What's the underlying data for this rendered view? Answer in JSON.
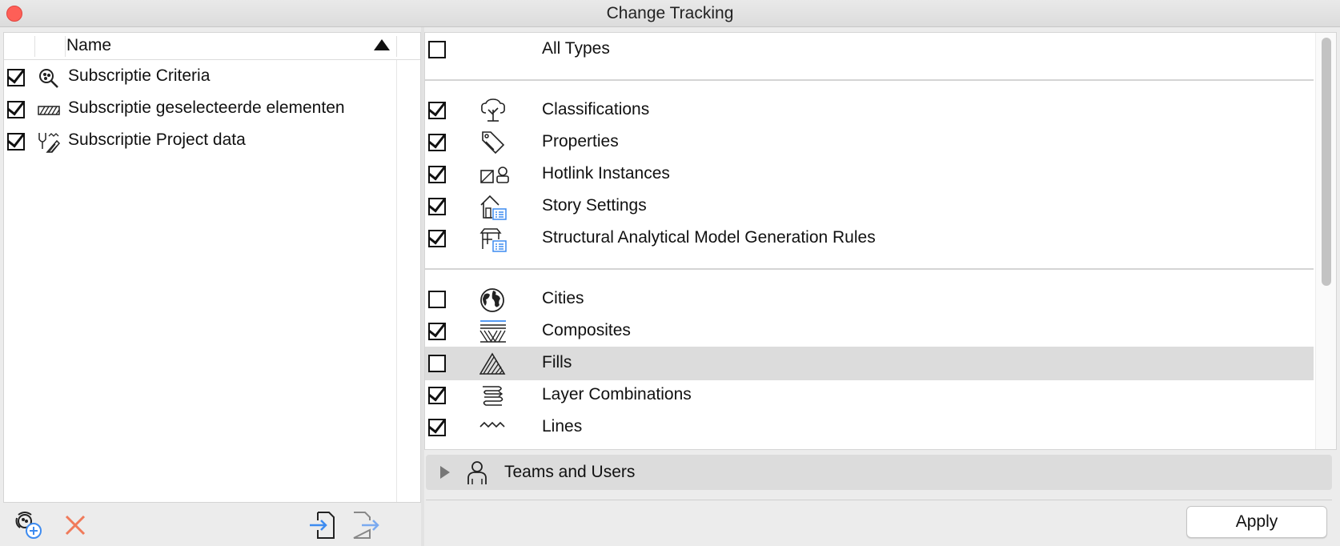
{
  "window": {
    "title": "Change Tracking"
  },
  "left": {
    "column_name": "Name",
    "rows": [
      {
        "label": "Subscriptie Criteria",
        "checked": true,
        "icon": "criteria-search-icon"
      },
      {
        "label": "Subscriptie geselecteerde elementen",
        "checked": true,
        "icon": "hatched-element-icon"
      },
      {
        "label": "Subscriptie Project data",
        "checked": true,
        "icon": "project-data-icon"
      }
    ],
    "toolbar": [
      "add-subscription-icon",
      "delete-icon",
      "import-icon",
      "export-icon"
    ]
  },
  "right": {
    "groups": [
      [
        {
          "label": "All Types",
          "checked": false,
          "icon": ""
        }
      ],
      [
        {
          "label": "Classifications",
          "checked": true,
          "icon": "tree-icon"
        },
        {
          "label": "Properties",
          "checked": true,
          "icon": "tag-icon"
        },
        {
          "label": "Hotlink Instances",
          "checked": true,
          "icon": "hotlink-icon"
        },
        {
          "label": "Story Settings",
          "checked": true,
          "icon": "story-settings-icon"
        },
        {
          "label": "Structural Analytical Model Generation Rules",
          "checked": true,
          "icon": "structural-model-icon"
        }
      ],
      [
        {
          "label": "Cities",
          "checked": false,
          "icon": "globe-icon"
        },
        {
          "label": "Composites",
          "checked": true,
          "icon": "composite-icon"
        },
        {
          "label": "Fills",
          "checked": false,
          "icon": "fill-icon",
          "selected": true
        },
        {
          "label": "Layer Combinations",
          "checked": true,
          "icon": "layers-icon"
        },
        {
          "label": "Lines",
          "checked": true,
          "icon": "line-icon"
        }
      ]
    ],
    "teams_section": "Teams and Users"
  },
  "apply_label": "Apply",
  "colors": {
    "close": "#fe5f57",
    "delete": "#f07a5a",
    "accent": "#3d8bf0",
    "selected_row": "#dcdcdc"
  }
}
